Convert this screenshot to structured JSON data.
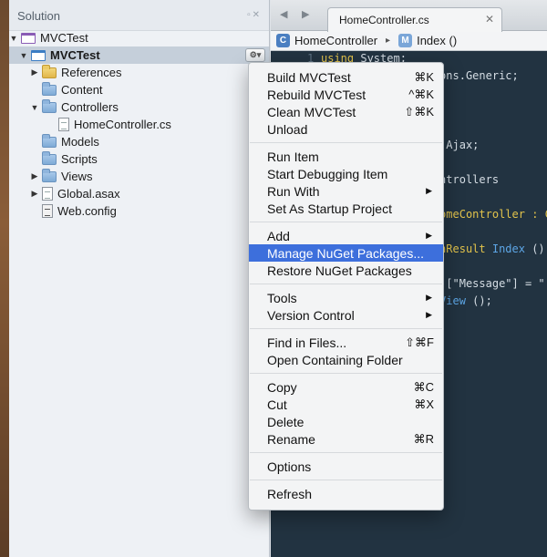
{
  "solution_pane": {
    "title": "Solution",
    "controls": "▫✕",
    "tree": [
      {
        "label": "MVCTest",
        "icon": "solution-icon",
        "arrow": "▼",
        "indent": 0
      },
      {
        "label": "MVCTest",
        "icon": "project-icon",
        "arrow": "▼",
        "indent": 1,
        "selected": true
      },
      {
        "label": "References",
        "icon": "folder-icon",
        "arrow": "▶",
        "indent": 2,
        "yellow": true
      },
      {
        "label": "Content",
        "icon": "folder-icon",
        "arrow": "",
        "indent": 2
      },
      {
        "label": "Controllers",
        "icon": "folder-icon",
        "arrow": "▼",
        "indent": 2
      },
      {
        "label": "HomeController.cs",
        "icon": "file-icon",
        "arrow": "",
        "indent": 3
      },
      {
        "label": "Models",
        "icon": "folder-icon",
        "arrow": "",
        "indent": 2
      },
      {
        "label": "Scripts",
        "icon": "folder-icon",
        "arrow": "",
        "indent": 2
      },
      {
        "label": "Views",
        "icon": "folder-icon",
        "arrow": "▶",
        "indent": 2
      },
      {
        "label": "Global.asax",
        "icon": "file-icon",
        "arrow": "▶",
        "indent": 2
      },
      {
        "label": "Web.config",
        "icon": "config-file-icon",
        "arrow": "",
        "indent": 2
      }
    ],
    "gear_label": "⚙▾"
  },
  "editor": {
    "nav_back": "◀",
    "nav_forward": "▶",
    "tab_title": "HomeController.cs",
    "tab_close": "✕",
    "path_class": "HomeController",
    "path_class_badge": "C",
    "path_sep": "▸",
    "path_method": "Index ()",
    "path_method_badge": "M"
  },
  "code": [
    {
      "ln": "1",
      "html": "<span class=\"kw\">using</span> System;"
    },
    {
      "ln": "",
      "html": "                 ions.Generic;"
    },
    {
      "ln": "",
      "html": ""
    },
    {
      "ln": "",
      "html": ""
    },
    {
      "ln": "",
      "html": "                 c;"
    },
    {
      "ln": "",
      "html": "                 c.Ajax;"
    },
    {
      "ln": "",
      "html": ""
    },
    {
      "ln": "",
      "html": "                 ontrollers"
    },
    {
      "ln": "",
      "html": ""
    },
    {
      "ln": "",
      "html": "                  <span class=\"ty\">omeController : Co</span>"
    },
    {
      "ln": "",
      "html": ""
    },
    {
      "ln": "",
      "html": "                 <span class=\"ty\">onResult</span> <span class=\"fn\">Index</span> ()"
    },
    {
      "ln": "",
      "html": ""
    },
    {
      "ln": "",
      "html": "                   [\"Message\"] = \""
    },
    {
      "ln": "",
      "html": "                  <span class=\"fn\">View</span> ();"
    }
  ],
  "context_menu": {
    "items": [
      {
        "label": "Build MVCTest",
        "shortcut": "⌘K"
      },
      {
        "label": "Rebuild MVCTest",
        "shortcut": "^⌘K"
      },
      {
        "label": "Clean MVCTest",
        "shortcut": "⇧⌘K"
      },
      {
        "label": "Unload",
        "shortcut": ""
      },
      {
        "sep": true
      },
      {
        "label": "Run Item",
        "shortcut": ""
      },
      {
        "label": "Start Debugging Item",
        "shortcut": ""
      },
      {
        "label": "Run With",
        "submenu": true
      },
      {
        "label": "Set As Startup Project",
        "shortcut": ""
      },
      {
        "sep": true
      },
      {
        "label": "Add",
        "submenu": true
      },
      {
        "label": "Manage NuGet Packages...",
        "highlighted": true
      },
      {
        "label": "Restore NuGet Packages",
        "shortcut": ""
      },
      {
        "sep": true
      },
      {
        "label": "Tools",
        "submenu": true
      },
      {
        "label": "Version Control",
        "submenu": true
      },
      {
        "sep": true
      },
      {
        "label": "Find in Files...",
        "shortcut": "⇧⌘F"
      },
      {
        "label": "Open Containing Folder",
        "shortcut": ""
      },
      {
        "sep": true
      },
      {
        "label": "Copy",
        "shortcut": "⌘C"
      },
      {
        "label": "Cut",
        "shortcut": "⌘X"
      },
      {
        "label": "Delete",
        "shortcut": ""
      },
      {
        "label": "Rename",
        "shortcut": "⌘R"
      },
      {
        "sep": true
      },
      {
        "label": "Options",
        "shortcut": ""
      },
      {
        "sep": true
      },
      {
        "label": "Refresh",
        "shortcut": ""
      }
    ],
    "submenu_arrow": "▶",
    "highlight_color": "#3d6fdc"
  }
}
